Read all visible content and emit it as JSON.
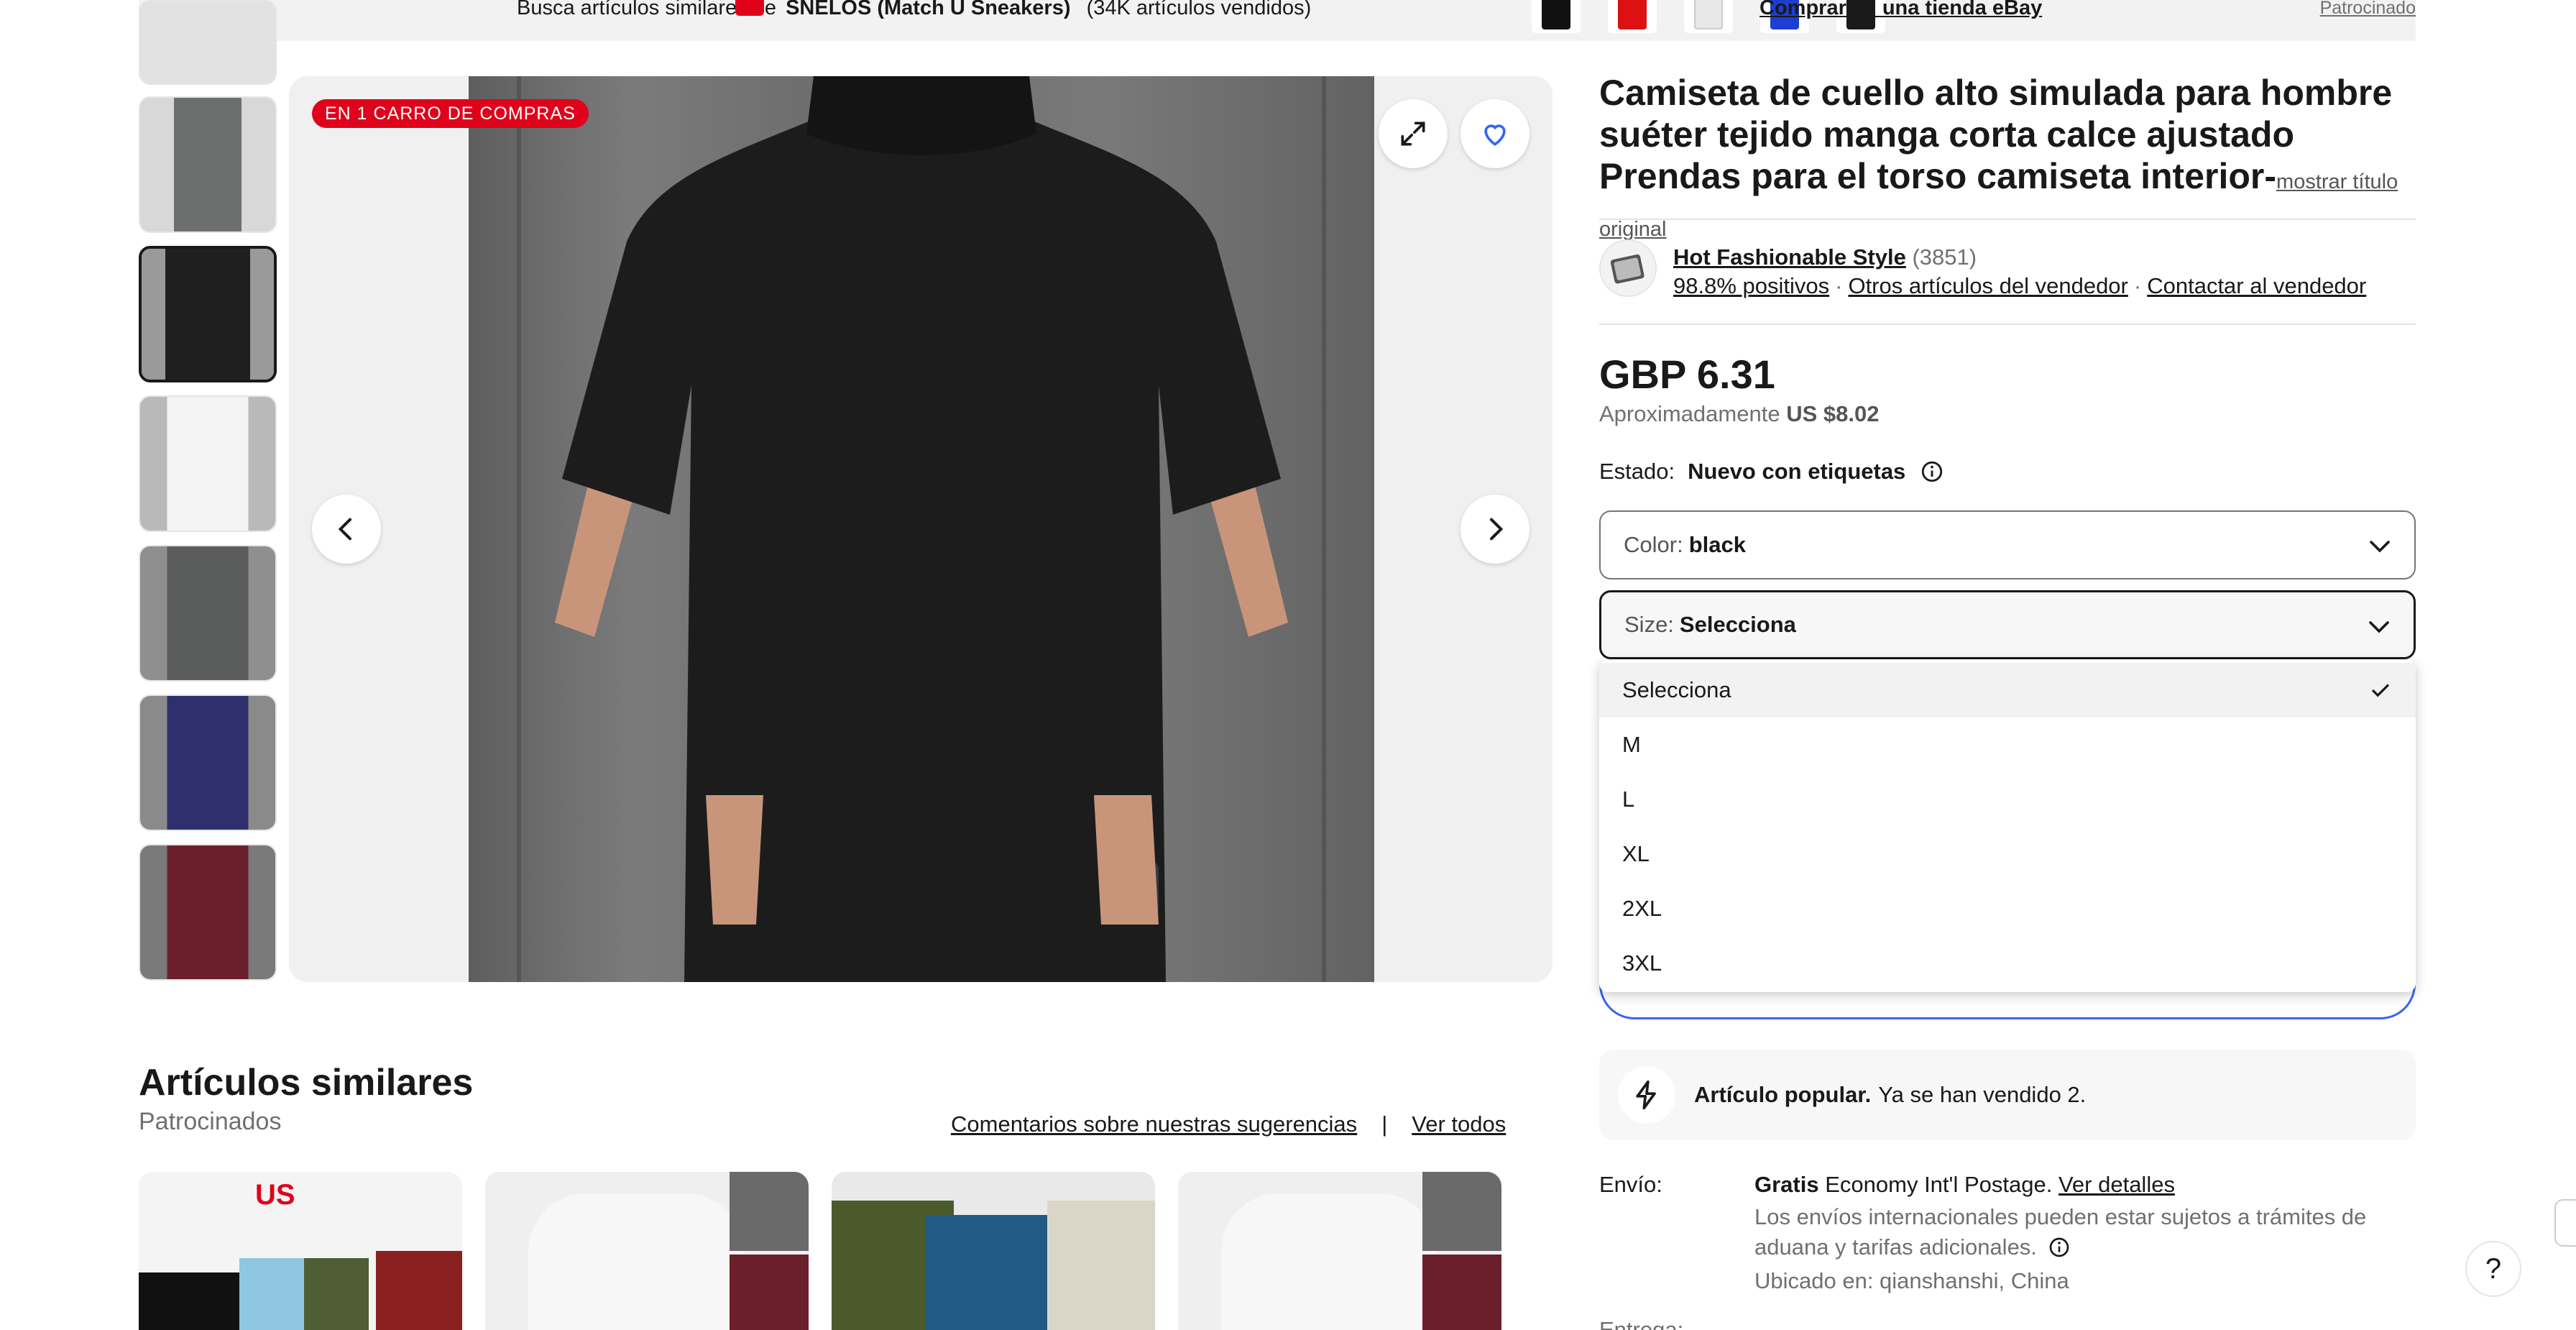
{
  "banner": {
    "prefix": "Busca artículos similares de",
    "brand": "SNELOS (Match U Sneakers)",
    "sold": "(34K artículos vendidos)",
    "shop_link": "Comprar en una tienda eBay",
    "sponsored": "Patrocinado"
  },
  "gallery": {
    "badge": "EN 1 CARRO DE COMPRAS",
    "thumb_colors": [
      "#6d6f6e",
      "#1f1f1f",
      "#f2f2f2",
      "#5b5c5c",
      "#2f2f6e",
      "#6a1f2a"
    ]
  },
  "product": {
    "title": "Camiseta de cuello alto simulada para hombre suéter tejido manga corta calce ajustado Prendas para el torso camiseta interior-",
    "show_original": "mostrar título original",
    "seller_name": "Hot Fashionable Style",
    "seller_count": "(3851)",
    "seller_positive": "98.8% positivos",
    "seller_other": "Otros artículos del vendedor",
    "seller_contact": "Contactar al vendedor",
    "price": "GBP 6.31",
    "approx_label": "Aproximadamente",
    "approx_value": "US $8.02",
    "estado_label": "Estado:",
    "estado_value": "Nuevo con etiquetas",
    "color_label": "Color:",
    "color_value": "black",
    "size_label": "Size:",
    "size_value": "Selecciona",
    "size_options": [
      "Selecciona",
      "M",
      "L",
      "XL",
      "2XL",
      "3XL"
    ],
    "popular_bold": "Artículo popular.",
    "popular_text": "Ya se han vendido 2.",
    "ship_label": "Envío:",
    "ship_free": "Gratis",
    "ship_method": "Economy Int'l Postage.",
    "ship_details": "Ver detalles",
    "ship_note": "Los envíos internacionales pueden estar sujetos a trámites de aduana y tarifas adicionales.",
    "ship_location": "Ubicado en: qianshanshi, China",
    "entrega_label": "Entrega:"
  },
  "similar": {
    "title": "Artículos similares",
    "subtitle": "Patrocinados",
    "feedback": "Comentarios sobre nuestras sugerencias",
    "separator": "|",
    "see_all": "Ver todos",
    "card1_badge": "US"
  },
  "help": "?",
  "colors": {
    "accent": "#3665f3",
    "badge": "#e0021a",
    "heart": "#3665f3"
  }
}
